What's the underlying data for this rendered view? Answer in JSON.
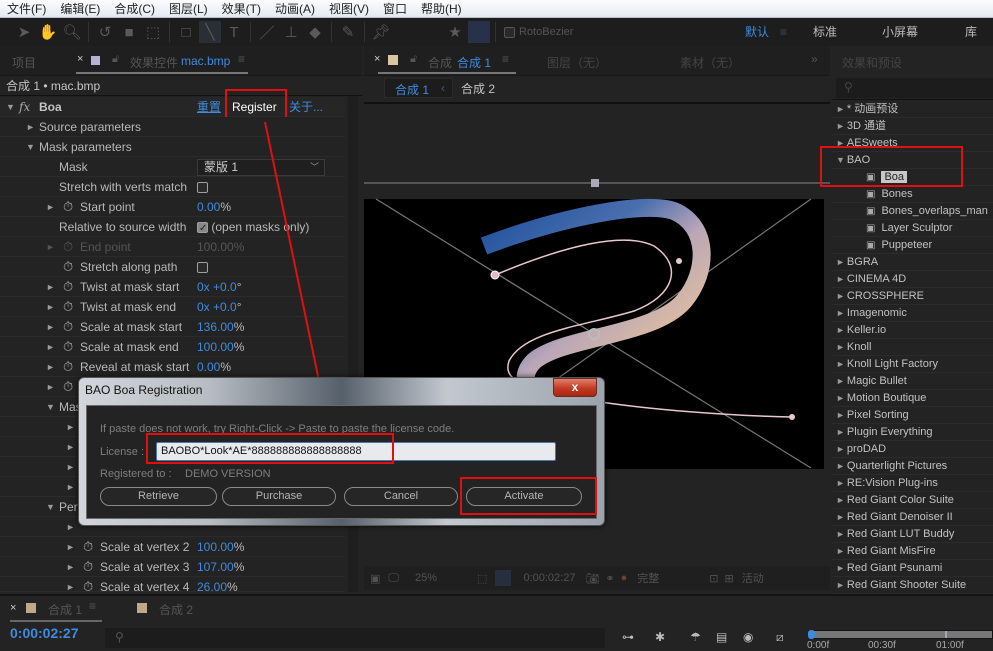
{
  "menu": [
    "文件(F)",
    "编辑(E)",
    "合成(C)",
    "图层(L)",
    "效果(T)",
    "动画(A)",
    "视图(V)",
    "窗口",
    "帮助(H)"
  ],
  "toolbar": {
    "rotobezier_label": "RotoBezier",
    "workspaces": [
      "默认",
      "标准",
      "小屏幕",
      "库"
    ],
    "active_workspace": "默认"
  },
  "left_panel": {
    "tab_project": "项目",
    "tab_effects_prefix": "效果控件",
    "tab_effects_file": "mac.bmp",
    "layer_path": "合成 1 • mac.bmp",
    "effect_name": "Boa",
    "reset_label": "重置",
    "register_label": "Register",
    "about_label": "关于...",
    "rows": [
      {
        "label": "Source parameters",
        "value": ""
      },
      {
        "label": "Mask parameters",
        "value": ""
      },
      {
        "label": "Mask",
        "value": "蒙版 1"
      },
      {
        "label": "Stretch with verts match",
        "value": ""
      },
      {
        "label": "Start point",
        "value": "0.00",
        "unit": "%"
      },
      {
        "label": "Relative to source width",
        "value": "(open masks only)"
      },
      {
        "label": "End point",
        "value": "100.00%"
      },
      {
        "label": "Stretch along path",
        "value": ""
      },
      {
        "label": "Twist at mask start",
        "value": "0x +0.0",
        "unit": "°"
      },
      {
        "label": "Twist at mask end",
        "value": "0x +0.0",
        "unit": "°"
      },
      {
        "label": "Scale at mask start",
        "value": "136.00",
        "unit": "%"
      },
      {
        "label": "Scale at mask end",
        "value": "100.00",
        "unit": "%"
      },
      {
        "label": "Reveal at mask start",
        "value": "0.00",
        "unit": "%"
      },
      {
        "label": "Mas",
        "value": ""
      },
      {
        "label": "Per",
        "value": ""
      },
      {
        "label": "Scale at vertex 2",
        "value": "100.00",
        "unit": "%"
      },
      {
        "label": "Scale at vertex 3",
        "value": "107.00",
        "unit": "%"
      },
      {
        "label": "Scale at vertex 4",
        "value": "26.00",
        "unit": "%"
      }
    ]
  },
  "comp_panel": {
    "tab_prefix": "合成",
    "tab_active": "合成 1",
    "tab_layer": "图层（无）",
    "tab_footage": "素材（无）",
    "breadcrumbs": [
      "合成 1",
      "合成 2"
    ],
    "zoom": "25%",
    "timecode": "0:00:02:27",
    "quality": "完整",
    "active_label": "活动"
  },
  "effects_panel": {
    "title": "效果和预设",
    "items": [
      {
        "label": "* 动画预设",
        "type": "folder",
        "open": false
      },
      {
        "label": "3D 通道",
        "type": "folder",
        "open": false
      },
      {
        "label": "AESweets",
        "type": "folder",
        "open": false
      },
      {
        "label": "BAO",
        "type": "folder",
        "open": true
      },
      {
        "label": "Boa",
        "type": "effect",
        "selected": true
      },
      {
        "label": "Bones",
        "type": "effect"
      },
      {
        "label": "Bones_overlaps_man",
        "type": "effect"
      },
      {
        "label": "Layer Sculptor",
        "type": "effect"
      },
      {
        "label": "Puppeteer",
        "type": "effect"
      },
      {
        "label": "BGRA",
        "type": "folder"
      },
      {
        "label": "CINEMA 4D",
        "type": "folder"
      },
      {
        "label": "CROSSPHERE",
        "type": "folder"
      },
      {
        "label": "Imagenomic",
        "type": "folder"
      },
      {
        "label": "Keller.io",
        "type": "folder"
      },
      {
        "label": "Knoll",
        "type": "folder"
      },
      {
        "label": "Knoll Light Factory",
        "type": "folder"
      },
      {
        "label": "Magic Bullet",
        "type": "folder"
      },
      {
        "label": "Motion Boutique",
        "type": "folder"
      },
      {
        "label": "Pixel Sorting",
        "type": "folder"
      },
      {
        "label": "Plugin Everything",
        "type": "folder"
      },
      {
        "label": "proDAD",
        "type": "folder"
      },
      {
        "label": "Quarterlight Pictures",
        "type": "folder"
      },
      {
        "label": "RE:Vision Plug-ins",
        "type": "folder"
      },
      {
        "label": "Red Giant Color Suite",
        "type": "folder"
      },
      {
        "label": "Red Giant Denoiser II",
        "type": "folder"
      },
      {
        "label": "Red Giant LUT Buddy",
        "type": "folder"
      },
      {
        "label": "Red Giant MisFire",
        "type": "folder"
      },
      {
        "label": "Red Giant Psunami",
        "type": "folder"
      },
      {
        "label": "Red Giant Shooter Suite",
        "type": "folder"
      }
    ]
  },
  "timeline": {
    "tabs": [
      "合成 1",
      "合成 2"
    ],
    "timecode": "0:00:02:27",
    "ruler": [
      "0:00f",
      "00:30f",
      "01:00f"
    ]
  },
  "dialog": {
    "title": "BAO Boa Registration",
    "close_label": "x",
    "hint": "If paste does not work, try Right-Click -> Paste to paste the license code.",
    "license_label": "License :",
    "license_value": "BAOBO*Look*AE*888888888888888888",
    "registered_label": "Registered to :",
    "registered_value": "DEMO VERSION",
    "buttons": [
      "Retrieve",
      "Purchase",
      "Cancel",
      "Activate"
    ]
  },
  "colors": {
    "accent": "#3f8bde",
    "highlight_box": "#e01010",
    "panel_bg": "#232323"
  }
}
